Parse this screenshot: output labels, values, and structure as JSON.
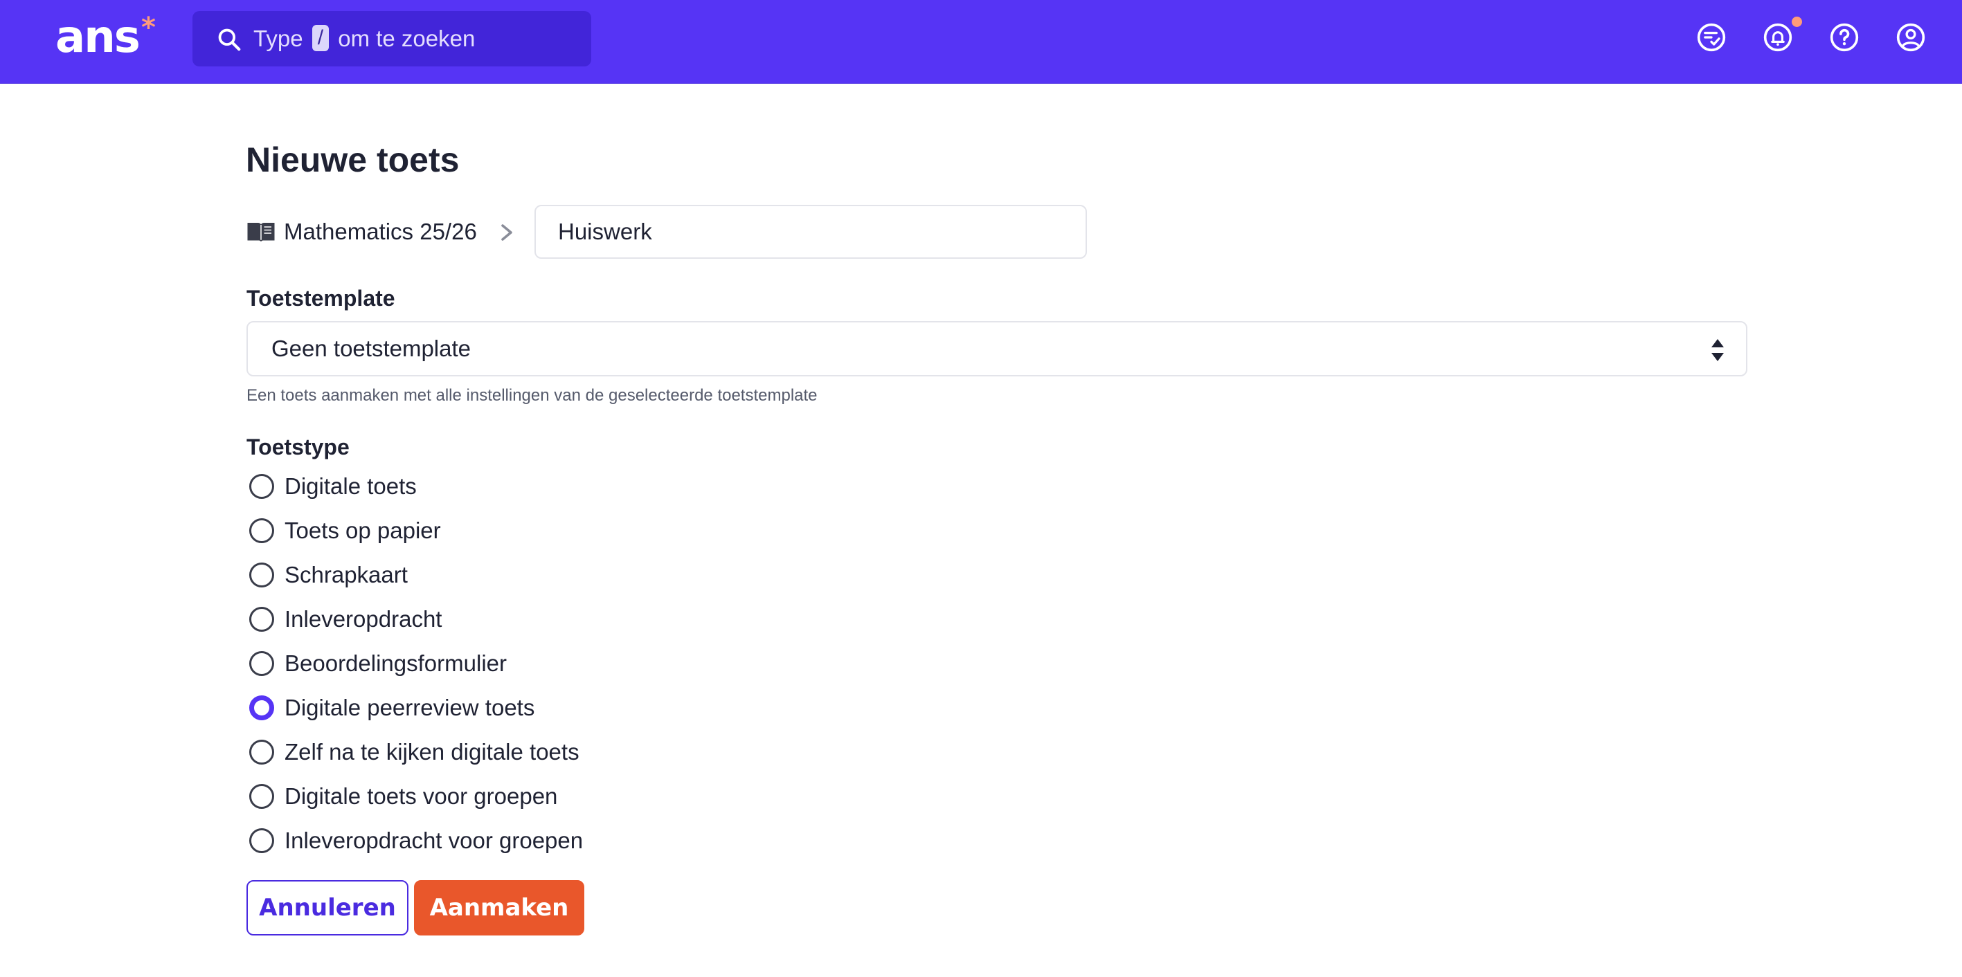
{
  "header": {
    "logo_text": "ans",
    "logo_mark": "*",
    "search": {
      "before": "Type",
      "key": "/",
      "after": "om te zoeken"
    },
    "icons": [
      "tasks-check-icon",
      "bell-icon",
      "help-icon",
      "user-account-icon"
    ],
    "has_notification": true
  },
  "page": {
    "title": "Nieuwe toets",
    "breadcrumb": {
      "course": "Mathematics 25/26",
      "title_value": "Huiswerk"
    },
    "template": {
      "label": "Toetstemplate",
      "selected": "Geen toetstemplate",
      "hint": "Een toets aanmaken met alle instellingen van de geselecteerde toetstemplate"
    },
    "type": {
      "label": "Toetstype",
      "options": [
        "Digitale toets",
        "Toets op papier",
        "Schrapkaart",
        "Inleveropdracht",
        "Beoordelingsformulier",
        "Digitale peerreview toets",
        "Zelf na te kijken digitale toets",
        "Digitale toets voor groepen",
        "Inleveropdracht voor groepen"
      ],
      "selected": "Digitale peerreview toets"
    },
    "buttons": {
      "cancel": "Annuleren",
      "create": "Aanmaken"
    }
  },
  "colors": {
    "brand": "#5634f5",
    "accent": "#e9572b",
    "notification": "#ff9c7a"
  }
}
